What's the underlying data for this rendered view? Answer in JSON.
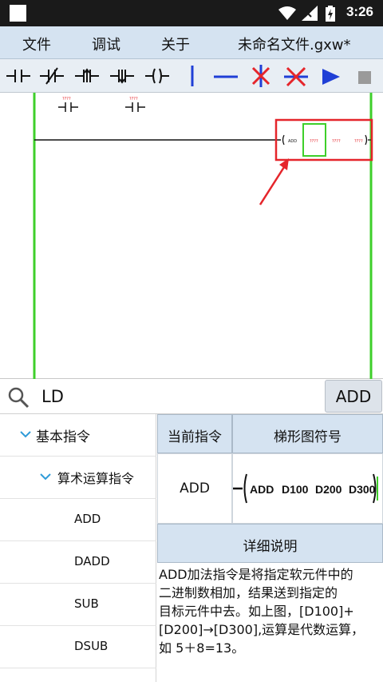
{
  "status_bar": {
    "time": "3:26"
  },
  "menu": {
    "file": "文件",
    "debug": "调试",
    "about": "关于",
    "document_title": "未命名文件.gxw*"
  },
  "ladder": {
    "contact_label_1": "????",
    "contact_label_2": "????",
    "instruction_name": "ADD",
    "operand_1": "????",
    "operand_2": "????",
    "operand_3": "????"
  },
  "search": {
    "query": "LD",
    "button_label": "ADD"
  },
  "tree": {
    "category": "基本指令",
    "subcategory": "算术运算指令",
    "items": [
      "ADD",
      "DADD",
      "SUB",
      "DSUB"
    ]
  },
  "detail": {
    "current_header": "当前指令",
    "symbol_header": "梯形图符号",
    "current_value": "ADD",
    "symbol": {
      "op": "ADD",
      "s1": "D100",
      "s2": "D200",
      "d": "D300"
    },
    "description_header": "详细说明",
    "description_lines": [
      "ADD加法指令是将指定软元件中的",
      "二进制数相加，结果送到指定的",
      "目标元件中去。如上图，[D100]+",
      "[D200]→[D300],运算是代数运算，",
      "如 5＋8=13。"
    ]
  },
  "colors": {
    "rail_green": "#3ecf2a",
    "selection_red": "#e5252b",
    "menu_bg": "#d5e3f1",
    "tool_blue": "#1f3fd6",
    "tool_red": "#e5252b",
    "tree_chevron": "#2f9bd8"
  }
}
